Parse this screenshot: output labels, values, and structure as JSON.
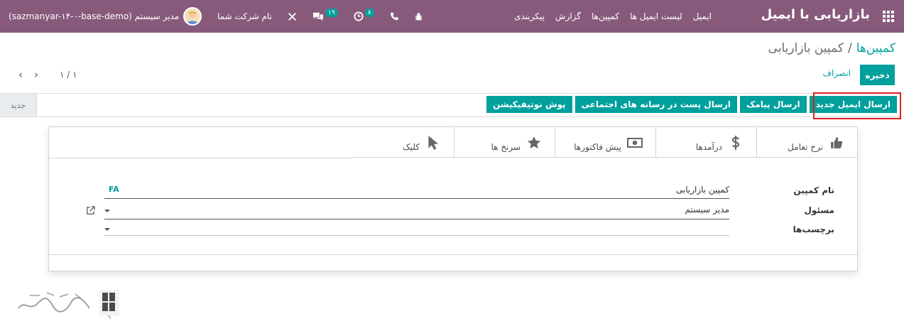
{
  "navbar": {
    "app_title": "بازاریابی با ایمیل",
    "menu": [
      "ایمیل",
      "لیست ایمیل ها",
      "کمپین‌ها",
      "گزارش",
      "پیکربندی"
    ],
    "company": "نام شرکت شما",
    "chat_badge": "۱۹",
    "activity_badge": "۸",
    "user": "مدیر سیستم (sazmanyar-۱۴-۰-base-demo)"
  },
  "breadcrumb": {
    "parent": "کمپین‌ها",
    "separator": "/",
    "current": "کمپین بازاریابی"
  },
  "control": {
    "save_label": "ذخیره",
    "discard_label": "انصراف",
    "pager_value": "۱ / ۱"
  },
  "statusbar": {
    "actions": [
      "ارسال ایمیل جدید",
      "ارسال پیامک",
      "ارسال پست در رسانه های اجتماعی",
      "پوش نوتیفیکیشن"
    ],
    "stage": "جدید"
  },
  "stat_buttons": [
    {
      "label": "نرخ تعامل",
      "icon": "thumbs-up-icon"
    },
    {
      "label": "درآمدها",
      "icon": "dollar-icon"
    },
    {
      "label": "پیش فاکتورها",
      "icon": "money-icon"
    },
    {
      "label": "سرنخ ها",
      "icon": "star-icon"
    },
    {
      "label": "کلیک",
      "icon": "cursor-icon"
    }
  ],
  "form": {
    "name_label": "نام کمپین",
    "name_value": "کمپین بازاریابی",
    "lang_button": "FA",
    "owner_label": "مسئول",
    "owner_value": "مدیر سیستم",
    "tags_label": "برچسب‌ها",
    "tags_value": ""
  },
  "colors": {
    "navbar": "#875a7b",
    "primary": "#00a09d",
    "highlight": "#e02020"
  }
}
